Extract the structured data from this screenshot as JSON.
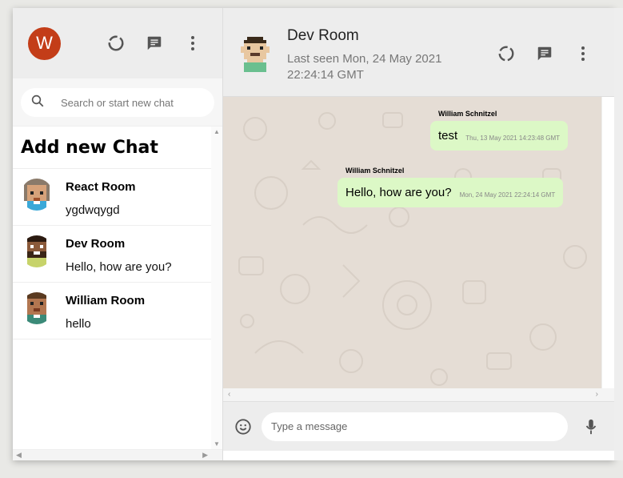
{
  "sidebar": {
    "user_initial": "W",
    "search_placeholder": "Search or start new chat",
    "add_chat_label": "Add new Chat",
    "chats": [
      {
        "name": "React Room",
        "last": "ygdwqygd"
      },
      {
        "name": "Dev Room",
        "last": "Hello, how are you?"
      },
      {
        "name": "William Room",
        "last": "hello"
      }
    ]
  },
  "header": {
    "room_name": "Dev Room",
    "last_seen": "Last seen Mon, 24 May 2021 22:24:14 GMT"
  },
  "messages": [
    {
      "sender": "William Schnitzel",
      "text": "test",
      "time": "Thu, 13 May 2021 14:23:48 GMT"
    },
    {
      "sender": "William Schnitzel",
      "text": "Hello, how are you?",
      "time": "Mon, 24 May 2021 22:24:14 GMT"
    }
  ],
  "footer": {
    "input_placeholder": "Type a message"
  },
  "colors": {
    "avatar_bg": "#c33d18",
    "bubble_bg": "#dcf8c6",
    "chat_bg": "#e5ddd5",
    "header_bg": "#ededed"
  },
  "icons": [
    "status-icon",
    "new-chat-icon",
    "menu-dots-icon",
    "search-icon",
    "emoji-icon",
    "mic-icon"
  ]
}
